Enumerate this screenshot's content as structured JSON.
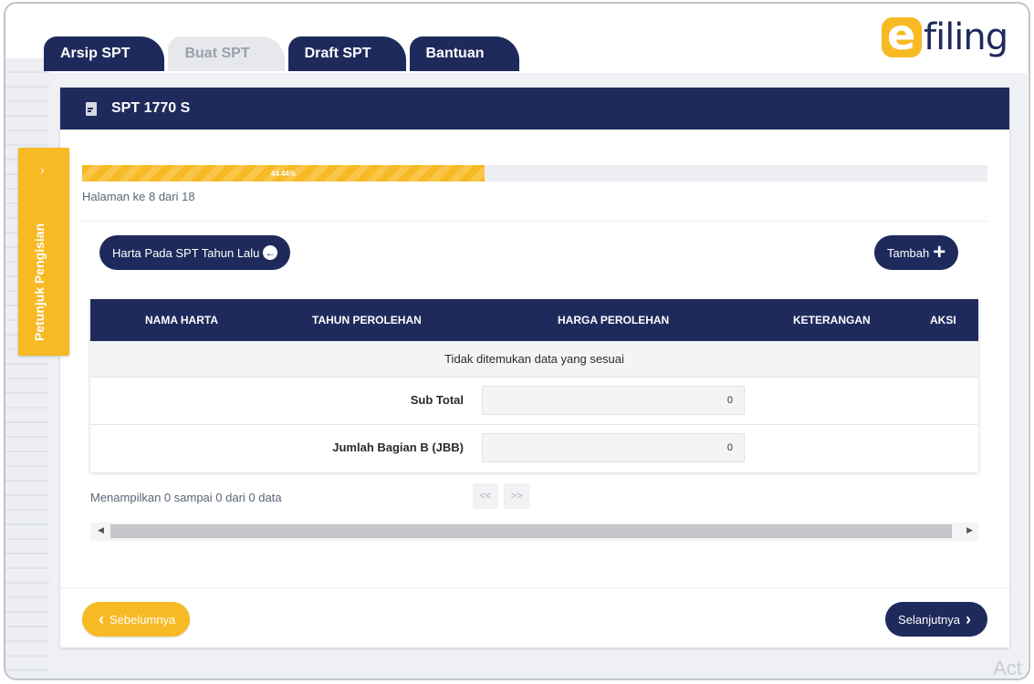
{
  "tabs": [
    {
      "label": "Arsip SPT",
      "active": true
    },
    {
      "label": "Buat SPT",
      "active": false
    },
    {
      "label": "Draft SPT",
      "active": true
    },
    {
      "label": "Bantuan",
      "active": true
    }
  ],
  "logo": {
    "badge": "e",
    "text": "filing"
  },
  "side_drawer": {
    "label": "Petunjuk Pengisian",
    "icon": "chevron-right-icon"
  },
  "panel": {
    "title": "SPT 1770 S",
    "icon": "document-icon"
  },
  "progress": {
    "percent": 44.44,
    "label": "44.44%",
    "page_info": "Halaman ke 8 dari 18"
  },
  "actions": {
    "previous_year_label": "Harta Pada SPT Tahun Lalu",
    "add_label": "Tambah"
  },
  "table": {
    "columns": [
      "NAMA HARTA",
      "TAHUN PEROLEHAN",
      "HARGA PEROLEHAN",
      "KETERANGAN",
      "AKSI"
    ],
    "empty_message": "Tidak ditemukan data yang sesuai",
    "sub_total_label": "Sub Total",
    "sub_total_value": "0",
    "jbb_label": "Jumlah Bagian B (JBB)",
    "jbb_value": "0"
  },
  "pagination": {
    "showing": "Menampilkan 0 sampai 0 dari 0 data",
    "prev": "<<",
    "next": ">>"
  },
  "footer": {
    "prev_label": "Sebelumnya",
    "next_label": "Selanjutnya"
  },
  "watermark": "Act",
  "colors": {
    "navy": "#1f2a5c",
    "accent": "#f7b924"
  }
}
